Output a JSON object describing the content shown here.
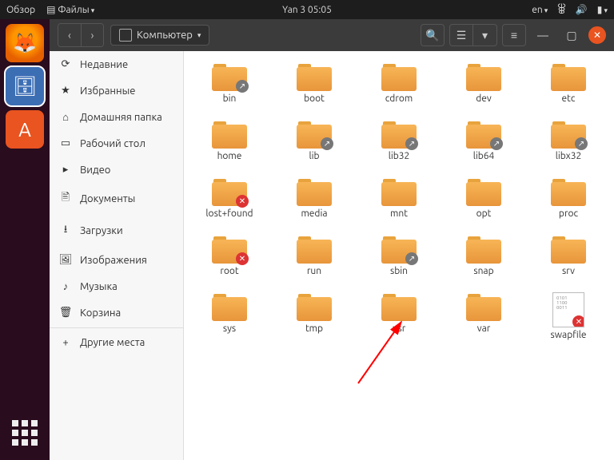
{
  "topbar": {
    "overview": "Обзор",
    "files": "Файлы",
    "clock": "Yan 3  05:05",
    "lang": "en"
  },
  "window": {
    "path_label": "Компьютер"
  },
  "sidebar": {
    "items": [
      {
        "icon": "⟳",
        "label": "Недавние"
      },
      {
        "icon": "★",
        "label": "Избранные"
      },
      {
        "icon": "⌂",
        "label": "Домашняя папка"
      },
      {
        "icon": "▭",
        "label": "Рабочий стол"
      },
      {
        "icon": "▸",
        "label": "Видео"
      },
      {
        "icon": "🖹",
        "label": "Документы"
      },
      {
        "icon": "⭳",
        "label": "Загрузки"
      },
      {
        "icon": "🖼",
        "label": "Изображения"
      },
      {
        "icon": "♪",
        "label": "Музыка"
      },
      {
        "icon": "🗑",
        "label": "Корзина"
      }
    ],
    "other": {
      "icon": "+",
      "label": "Другие места"
    }
  },
  "files": [
    {
      "name": "bin",
      "type": "folder",
      "badge": "link"
    },
    {
      "name": "boot",
      "type": "folder"
    },
    {
      "name": "cdrom",
      "type": "folder"
    },
    {
      "name": "dev",
      "type": "folder"
    },
    {
      "name": "etc",
      "type": "folder"
    },
    {
      "name": "home",
      "type": "folder"
    },
    {
      "name": "lib",
      "type": "folder",
      "badge": "link"
    },
    {
      "name": "lib32",
      "type": "folder",
      "badge": "link"
    },
    {
      "name": "lib64",
      "type": "folder",
      "badge": "link"
    },
    {
      "name": "libx32",
      "type": "folder",
      "badge": "link"
    },
    {
      "name": "lost+found",
      "type": "folder",
      "badge": "deny"
    },
    {
      "name": "media",
      "type": "folder"
    },
    {
      "name": "mnt",
      "type": "folder"
    },
    {
      "name": "opt",
      "type": "folder"
    },
    {
      "name": "proc",
      "type": "folder"
    },
    {
      "name": "root",
      "type": "folder",
      "badge": "deny"
    },
    {
      "name": "run",
      "type": "folder"
    },
    {
      "name": "sbin",
      "type": "folder",
      "badge": "link"
    },
    {
      "name": "snap",
      "type": "folder"
    },
    {
      "name": "srv",
      "type": "folder"
    },
    {
      "name": "sys",
      "type": "folder"
    },
    {
      "name": "tmp",
      "type": "folder"
    },
    {
      "name": "usr",
      "type": "folder"
    },
    {
      "name": "var",
      "type": "folder"
    },
    {
      "name": "swapfile",
      "type": "file",
      "badge": "deny"
    }
  ],
  "arrow": {
    "target_index": 22
  }
}
